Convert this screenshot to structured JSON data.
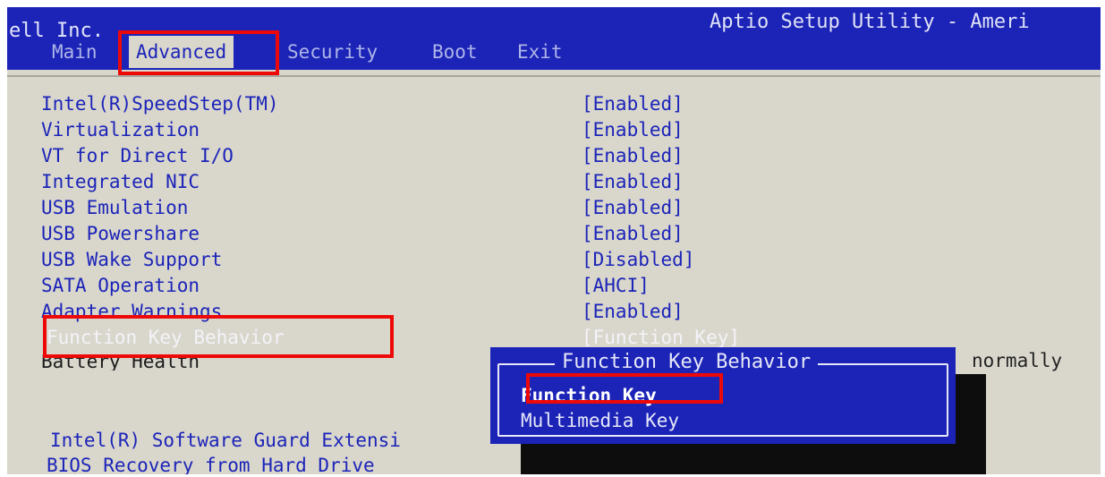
{
  "header": {
    "vendor": "ell Inc.",
    "utility": "Aptio Setup Utility - Ameri",
    "tabs": [
      {
        "label": "Main"
      },
      {
        "label": "Advanced",
        "active": true
      },
      {
        "label": "Security"
      },
      {
        "label": "Boot"
      },
      {
        "label": "Exit"
      }
    ]
  },
  "settings": [
    {
      "label": "Intel(R)SpeedStep(TM)",
      "value": "[Enabled]"
    },
    {
      "label": "Virtualization",
      "value": "[Enabled]"
    },
    {
      "label": "VT for Direct I/O",
      "value": "[Enabled]"
    },
    {
      "label": "Integrated NIC",
      "value": "[Enabled]"
    },
    {
      "label": "USB Emulation",
      "value": "[Enabled]"
    },
    {
      "label": "USB Powershare",
      "value": "[Enabled]"
    },
    {
      "label": "USB Wake Support",
      "value": "[Disabled]"
    },
    {
      "label": "SATA Operation",
      "value": "[AHCI]"
    },
    {
      "label": "Adapter Warnings",
      "value": "[Enabled]"
    },
    {
      "label": "Function Key Behavior",
      "value": "[Function Key]",
      "selected": true
    },
    {
      "label": "Battery Health",
      "value": ""
    },
    {
      "label": "Intel(R) Software Guard Extensi",
      "value": ""
    },
    {
      "label": "BIOS Recovery from Hard Drive",
      "value": ""
    }
  ],
  "help_text": "normally",
  "popup": {
    "title": "Function Key Behavior",
    "options": [
      {
        "label": "Function Key",
        "highlighted": true
      },
      {
        "label": "Multimedia Key"
      }
    ]
  },
  "colors": {
    "bios_blue": "#1c24b8",
    "background": "#d9d7cc",
    "annotation_red": "#ee0909"
  }
}
